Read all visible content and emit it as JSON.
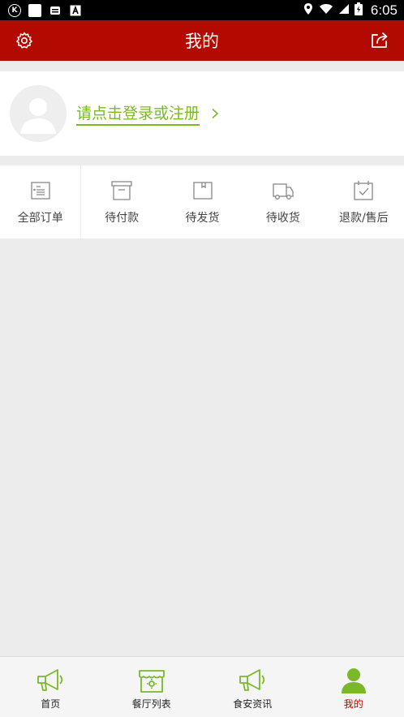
{
  "status_bar": {
    "time": "6:05",
    "left_icons": [
      "k-app-icon",
      "blank-app-icon",
      "notification-icon",
      "a-app-icon"
    ],
    "right_icons": [
      "location-icon",
      "wifi-icon",
      "signal-icon",
      "battery-icon"
    ]
  },
  "header": {
    "title": "我的",
    "left_icon": "gear-icon",
    "right_icon": "share-icon",
    "color": "#b30a00"
  },
  "login": {
    "prompt": "请点击登录或注册",
    "color": "#7ab82a"
  },
  "orders": [
    {
      "label": "全部订单",
      "icon": "order-list-icon"
    },
    {
      "label": "待付款",
      "icon": "wallet-box-icon"
    },
    {
      "label": "待发货",
      "icon": "package-icon"
    },
    {
      "label": "待收货",
      "icon": "truck-icon"
    },
    {
      "label": "退款/售后",
      "icon": "calendar-check-icon"
    }
  ],
  "bottom_nav": [
    {
      "label": "首页",
      "icon": "megaphone-icon"
    },
    {
      "label": "餐厅列表",
      "icon": "restaurant-icon"
    },
    {
      "label": "食安资讯",
      "icon": "megaphone-icon"
    },
    {
      "label": "我的",
      "icon": "person-icon",
      "active": true
    }
  ]
}
